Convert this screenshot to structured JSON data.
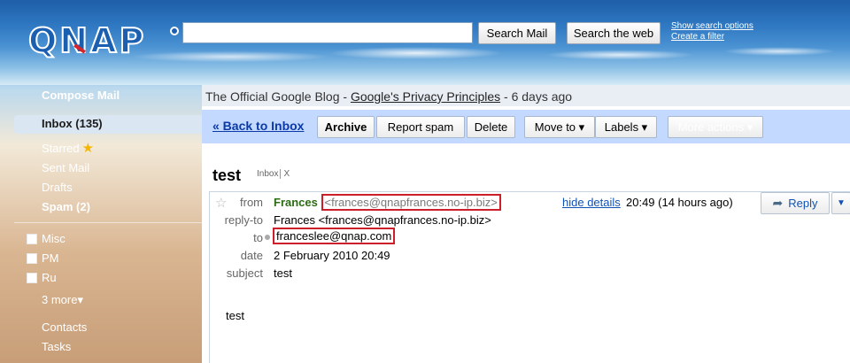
{
  "header": {
    "logo_text": "QNAP",
    "search_value": "",
    "search_mail_label": "Search Mail",
    "search_web_label": "Search the web",
    "show_search_options": "Show search options",
    "create_filter": "Create a filter"
  },
  "nav": {
    "compose": "Compose Mail",
    "inbox": "Inbox (135)",
    "starred": "Starred",
    "sent": "Sent Mail",
    "drafts": "Drafts",
    "spam": "Spam (2)",
    "labels": [
      "Misc",
      "PM",
      "Ru"
    ],
    "more": "3 more▾",
    "contacts": "Contacts",
    "tasks": "Tasks"
  },
  "webclip": {
    "prefix": "The Official Google Blog - ",
    "link": "Google's Privacy Principles",
    "suffix": " - 6 days ago"
  },
  "toolbar": {
    "back": "« Back to Inbox",
    "archive": "Archive",
    "report_spam": "Report spam",
    "delete": "Delete",
    "move_to": "Move to ▾",
    "labels": "Labels ▾",
    "more_actions": "More actions ▾"
  },
  "message": {
    "subject": "test",
    "tag": "Inbox",
    "tag_close": "X",
    "from_label": "from",
    "sender_name": "Frances",
    "sender_email": "<frances@qnapfrances.no-ip.biz>",
    "hide_details": "hide details",
    "time": "20:49 (14 hours ago)",
    "reply": "Reply",
    "reply_to_label": "reply-to",
    "reply_to_value": "Frances <frances@qnapfrances.no-ip.biz>",
    "to_label": "to",
    "to_value": "franceslee@qnap.com",
    "date_label": "date",
    "date_value": "2 February 2010 20:49",
    "subject_label": "subject",
    "subject_value": "test",
    "body": "test"
  },
  "colors": {
    "accent_blue": "#c3d9ff",
    "highlight_red": "#cc1f2a",
    "sender_green": "#2b6c12"
  }
}
